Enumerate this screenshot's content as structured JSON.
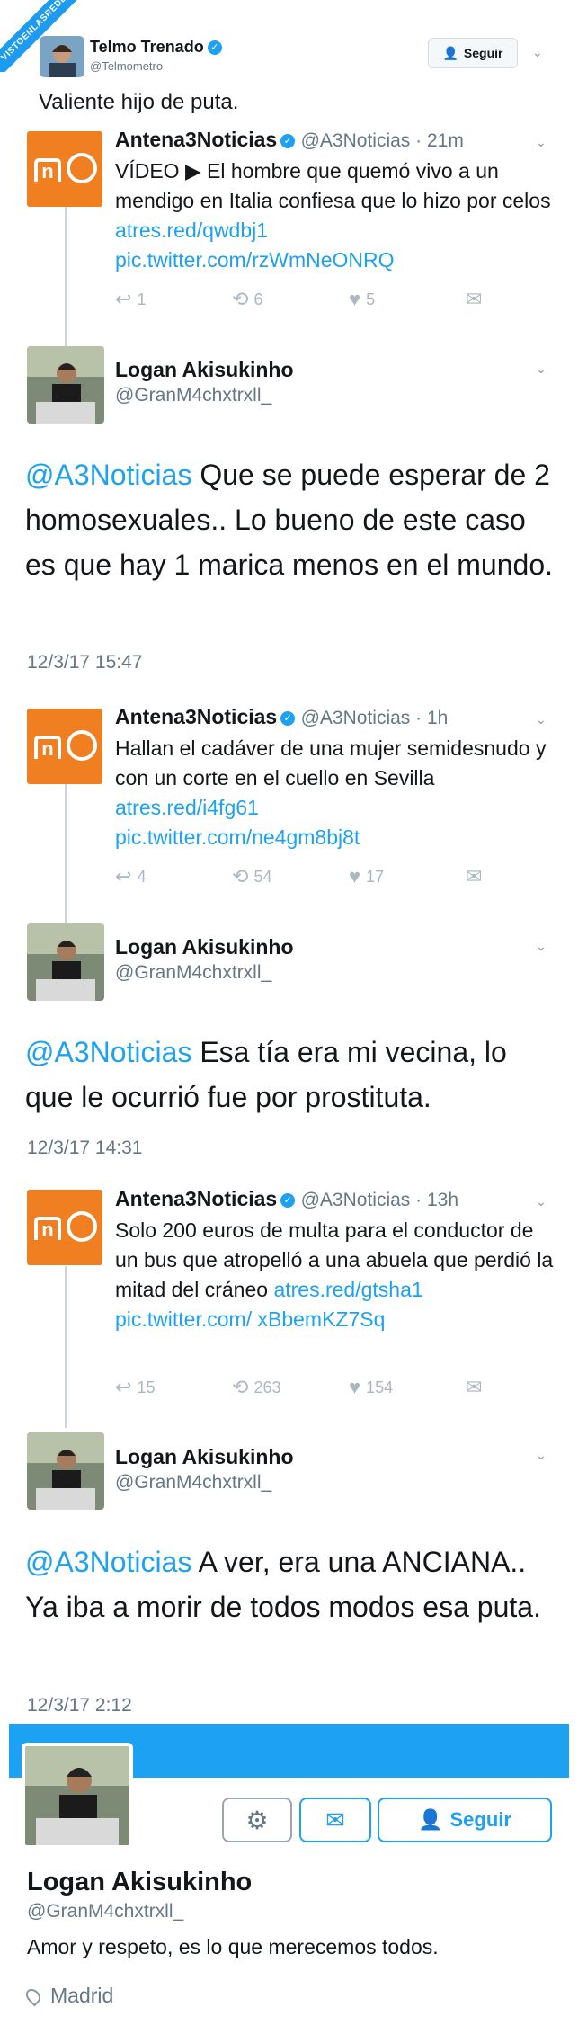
{
  "watermark": "VISTOENLASREDES",
  "header": {
    "name": "Telmo Trenado",
    "handle": "@Telmometro",
    "follow_label": "Seguir",
    "intro_text": "Valiente hijo de puta."
  },
  "threads": [
    {
      "quote": {
        "name": "Antena3Noticias",
        "handle": "@A3Noticias",
        "time": "21m",
        "text": "VÍDEO ▶ El hombre que quemó vivo a un mendigo en Italia confiesa que lo hizo por celos ",
        "link1": "atres.red/qwdbj1",
        "link2": "pic.twitter.com/rzWmNeONRQ",
        "replies": "1",
        "retweets": "6",
        "likes": "5"
      },
      "reply": {
        "name": "Logan Akisukinho",
        "handle": "@GranM4chxtrxll_",
        "mention": "@A3Noticias",
        "text": " Que se puede esperar de 2 homosexuales.. Lo bueno de este caso es que hay 1 marica menos en el mundo.",
        "timestamp": "12/3/17 15:47"
      }
    },
    {
      "quote": {
        "name": "Antena3Noticias",
        "handle": "@A3Noticias",
        "time": "1h",
        "text": "Hallan el cadáver de una mujer semidesnudo y con un corte en el cuello en Sevilla ",
        "link1": "atres.red/i4fg61",
        "link2": "pic.twitter.com/ne4gm8bj8t",
        "replies": "4",
        "retweets": "54",
        "likes": "17"
      },
      "reply": {
        "name": "Logan Akisukinho",
        "handle": "@GranM4chxtrxll_",
        "mention": "@A3Noticias",
        "text": " Esa tía era mi vecina, lo que le ocurrió fue por prostituta.",
        "timestamp": "12/3/17 14:31"
      }
    },
    {
      "quote": {
        "name": "Antena3Noticias",
        "handle": "@A3Noticias",
        "time": "13h",
        "text": "Solo 200 euros de multa para el conductor de un bus que atropelló a una abuela que perdió la mitad del cráneo ",
        "link1": "atres.red/gtsha1",
        "link2": "pic.twitter.com/ xBbemKZ7Sq",
        "replies": "15",
        "retweets": "263",
        "likes": "154"
      },
      "reply": {
        "name": "Logan Akisukinho",
        "handle": "@GranM4chxtrxll_",
        "mention": "@A3Noticias",
        "text": " A ver, era una ANCIANA.. Ya iba a morir de todos modos esa puta.",
        "timestamp": "12/3/17 2:12"
      }
    }
  ],
  "profile": {
    "name": "Logan Akisukinho",
    "handle": "@GranM4chxtrxll_",
    "bio": "Amor y respeto, es lo que merecemos todos.",
    "location": "Madrid",
    "follow_label": "Seguir"
  },
  "colors": {
    "accent": "#1da1f2",
    "antena3": "#f07f21",
    "muted": "#657786"
  }
}
